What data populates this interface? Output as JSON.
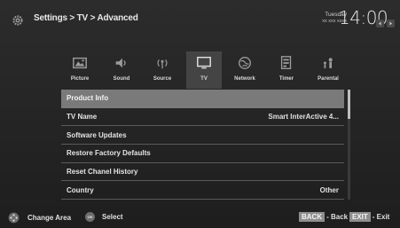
{
  "header": {
    "breadcrumb": "Settings > TV > Advanced",
    "day": "Tuesday",
    "date": "xx xxx xxxx",
    "time": "14:00",
    "icons": [
      "gear-icon",
      "arrow-left-icon",
      "arrow-right-icon"
    ]
  },
  "tabs": [
    {
      "label": "Picture",
      "icon": "picture-icon",
      "active": false
    },
    {
      "label": "Sound",
      "icon": "sound-icon",
      "active": false
    },
    {
      "label": "Source",
      "icon": "source-icon",
      "active": false
    },
    {
      "label": "TV",
      "icon": "tv-icon",
      "active": true
    },
    {
      "label": "Network",
      "icon": "network-icon",
      "active": false
    },
    {
      "label": "Timer",
      "icon": "timer-icon",
      "active": false
    },
    {
      "label": "Parental",
      "icon": "parental-icon",
      "active": false
    }
  ],
  "menu": [
    {
      "label": "Product Info",
      "value": "",
      "selected": true
    },
    {
      "label": "TV Name",
      "value": "Smart InterActive 4...",
      "selected": false
    },
    {
      "label": "Software Updates",
      "value": "",
      "selected": false
    },
    {
      "label": "Restore Factory Defaults",
      "value": "",
      "selected": false
    },
    {
      "label": "Reset Chanel History",
      "value": "",
      "selected": false
    },
    {
      "label": "Country",
      "value": "Other",
      "selected": false
    }
  ],
  "scroll_fraction": 0.27,
  "footer": {
    "change_area": "Change Area",
    "ok_key": "OK",
    "select": "Select",
    "back_key": "BACK",
    "back": "- Back",
    "exit_key": "EXIT",
    "exit": "- Exit"
  },
  "colors": {
    "background": "#262626",
    "selected_row": "#7a7a7a",
    "active_tab": "#444444",
    "text": "#e6e6e6"
  }
}
